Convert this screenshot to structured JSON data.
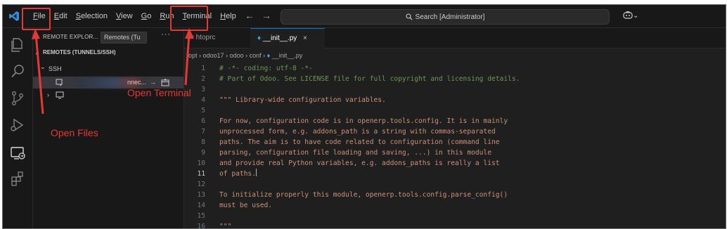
{
  "menu": [
    "File",
    "Edit",
    "Selection",
    "View",
    "Go",
    "Run",
    "Terminal",
    "Help"
  ],
  "nav": {
    "back": "←",
    "forward": "→"
  },
  "command_center": {
    "text": "Search [Administrator]"
  },
  "copilot": {
    "icon": "copilot-icon",
    "caret": "⌄"
  },
  "activity_bar": [
    "explorer-icon",
    "search-icon",
    "source-control-icon",
    "run-debug-icon",
    "remote-explorer-icon",
    "extensions-icon"
  ],
  "sidebar": {
    "title": "REMOTE EXPLOR...",
    "select_value": "Remotes (Tu",
    "more": "···",
    "section": "REMOTES (TUNNELS/SSH)",
    "group": "SSH",
    "row1_suffix": "nnec...",
    "row1_arrow": "→"
  },
  "tabs": [
    {
      "label": "htoprc",
      "active": false
    },
    {
      "label": "__init__.py",
      "active": true
    }
  ],
  "breadcrumb": [
    "opt",
    "odoo17",
    "odoo",
    "conf",
    "__init__.py"
  ],
  "code": [
    {
      "n": "1",
      "text": "# -*- coding: utf-8 -*-",
      "kind": "comment"
    },
    {
      "n": "2",
      "text": "# Part of Odoo. See LICENSE file for full copyright and licensing details.",
      "kind": "comment"
    },
    {
      "n": "3",
      "text": "",
      "kind": "string"
    },
    {
      "n": "4",
      "text": "\"\"\" Library-wide configuration variables.",
      "kind": "string"
    },
    {
      "n": "5",
      "text": "",
      "kind": "string"
    },
    {
      "n": "6",
      "text": "For now, configuration code is in openerp.tools.config. It is in mainly",
      "kind": "string"
    },
    {
      "n": "7",
      "text": "unprocessed form, e.g. addons_path is a string with commas-separated",
      "kind": "string"
    },
    {
      "n": "8",
      "text": "paths. The aim is to have code related to configuration (command line",
      "kind": "string"
    },
    {
      "n": "9",
      "text": "parsing, configuration file loading and saving, ...) in this module",
      "kind": "string"
    },
    {
      "n": "10",
      "text": "and provide real Python variables, e.g. addons_paths is really a list",
      "kind": "string"
    },
    {
      "n": "11",
      "text": "of paths.",
      "kind": "string"
    },
    {
      "n": "12",
      "text": "",
      "kind": "string"
    },
    {
      "n": "13",
      "text": "To initialize properly this module, openerp.tools.config.parse_config()",
      "kind": "string"
    },
    {
      "n": "14",
      "text": "must be used.",
      "kind": "string"
    },
    {
      "n": "15",
      "text": "",
      "kind": "string"
    },
    {
      "n": "16",
      "text": "\"\"\"",
      "kind": "string"
    }
  ],
  "annotations": {
    "open_terminal": "Open Terminal",
    "open_files": "Open Files",
    "color": "#e53935"
  },
  "colors": {
    "background": "#1f1f1f",
    "accent": "#0078d4",
    "string": "#ce9178",
    "comment": "#6a9955"
  }
}
